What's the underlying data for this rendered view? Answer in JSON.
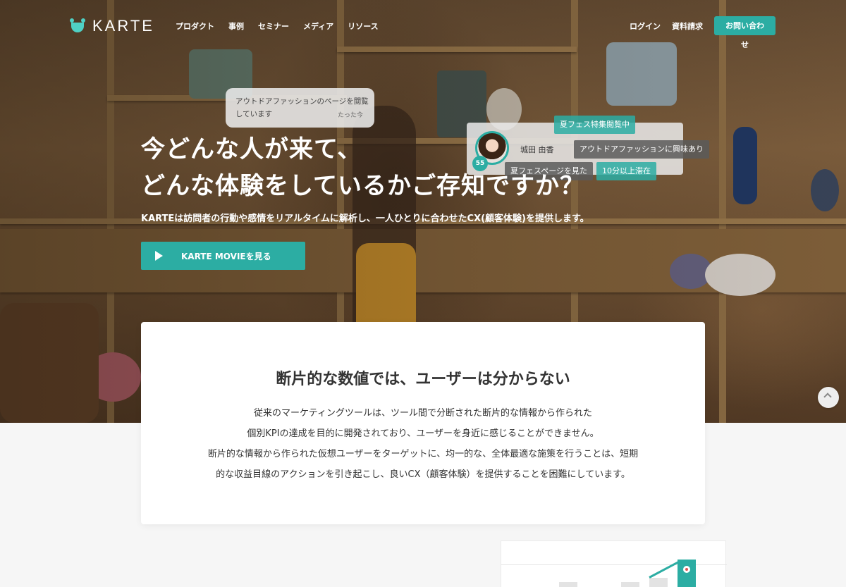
{
  "brand": {
    "name": "KARTE",
    "accent": "#2cada3"
  },
  "nav": {
    "menu": [
      "プロダクト",
      "事例",
      "セミナー",
      "メディア",
      "リソース"
    ],
    "login": "ログイン",
    "request_docs": "資料請求",
    "contact": "お問い合わせ"
  },
  "hero": {
    "bubble": {
      "text": "アウトドアファッションのページを閲覧しています",
      "time": "たった今"
    },
    "profile": {
      "name": "城田 由香",
      "score": "55",
      "tags": [
        "夏フェス特集閲覧中",
        "アウトドアファッションに興味あり",
        "夏フェスページを見た",
        "10分以上滞在"
      ]
    },
    "headline_line1": "今どんな人が来て、",
    "headline_line2": "どんな体験をしているかご存知ですか？",
    "subtext": "KARTEは訪問者の行動や感情をリアルタイムに解析し、一人ひとりに合わせたCX(顧客体験)を提供します。",
    "movie_button": "KARTE MOVIEを見る"
  },
  "section": {
    "title": "断片的な数値では、ユーザーは分からない",
    "lines": [
      "従来のマーケティングツールは、ツール間で分断された断片的な情報から作られた",
      "個別KPIの達成を目的に開発されており、ユーザーを身近に感じることができません。",
      "断片的な情報から作られた仮想ユーザーをターゲットに、均一的な、全体最適な施策を行うことは、短期",
      "的な収益目線のアクションを引き起こし、良いCX（顧客体験）を提供することを困難にしています。"
    ]
  }
}
